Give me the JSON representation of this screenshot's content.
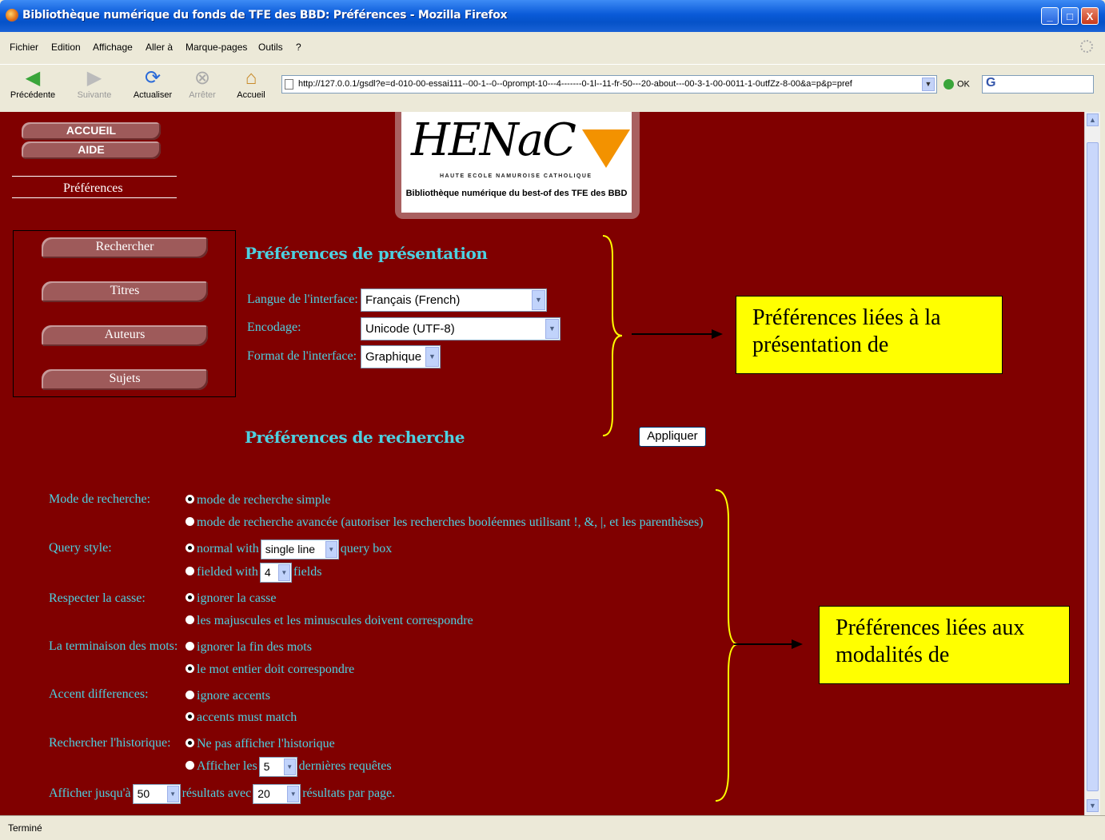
{
  "window": {
    "title": "Bibliothèque numérique du fonds de TFE des BBD: Préférences - Mozilla Firefox",
    "min_label": "_",
    "max_label": "□",
    "close_label": "X"
  },
  "menu": [
    "Fichier",
    "Edition",
    "Affichage",
    "Aller à",
    "Marque-pages",
    "Outils",
    "?"
  ],
  "nav": {
    "back": "Précédente",
    "forward": "Suivante",
    "reload": "Actualiser",
    "stop": "Arrêter",
    "home": "Accueil"
  },
  "address": {
    "url": "http://127.0.0.1/gsdl?e=d-010-00-essai111--00-1--0--0prompt-10---4-------0-1l--11-fr-50---20-about---00-3-1-00-0011-1-0utfZz-8-00&a=p&p=pref",
    "go_label": "OK",
    "search_logo": "G"
  },
  "status": "Terminé",
  "sidebar": {
    "home": "ACCUEIL",
    "help": "AIDE",
    "prefs": "Préférences"
  },
  "logo": {
    "name": "HENaC",
    "school": "HAUTE ECOLE NAMUROISE CATHOLIQUE",
    "caption": "Bibliothèque numérique du best-of des TFE des BBD"
  },
  "leftnav": [
    "Rechercher",
    "Titres",
    "Auteurs",
    "Sujets"
  ],
  "presentation": {
    "heading": "Préférences de présentation",
    "language_label": "Langue de l'interface:",
    "language_value": "Français (French)",
    "encoding_label": "Encodage:",
    "encoding_value": "Unicode (UTF-8)",
    "format_label": "Format de l'interface:",
    "format_value": "Graphique"
  },
  "search": {
    "heading": "Préférences de recherche",
    "apply": "Appliquer",
    "mode_label": "Mode de recherche:",
    "mode_simple": "mode de recherche simple",
    "mode_advanced": "mode de recherche avancée (autoriser les recherches booléennes utilisant !, &, |, et les parenthèses)",
    "query_label": "Query style:",
    "query_normal_pre": "normal with",
    "query_box_value": "single line",
    "query_normal_post": "query box",
    "query_fielded_pre": "fielded with",
    "query_fields_value": "4",
    "query_fielded_post": "fields",
    "case_label": "Respecter la casse:",
    "case_ignore": "ignorer la casse",
    "case_match": "les majuscules et les minuscules doivent correspondre",
    "stem_label": "La terminaison des mots:",
    "stem_ignore": "ignorer la fin des mots",
    "stem_match": "le mot entier doit correspondre",
    "accent_label": "Accent differences:",
    "accent_ignore": "ignore accents",
    "accent_match": "accents must match",
    "history_label": "Rechercher l'historique:",
    "history_hide": "Ne pas afficher l'historique",
    "history_show_pre": "Afficher les",
    "history_count": "5",
    "history_show_post": "dernières requêtes",
    "results_pre": "Afficher jusqu'à",
    "results_max": "50",
    "results_mid": "résultats avec",
    "results_per_page": "20",
    "results_post": "résultats par page."
  },
  "callouts": {
    "top": "Préférences liées à la présentation de",
    "bottom": "Préférences liées aux modalités de"
  },
  "colors": {
    "page_bg": "#800000",
    "label": "#4dd0e0",
    "callout": "#ffff00",
    "brace": "#ffff00"
  }
}
